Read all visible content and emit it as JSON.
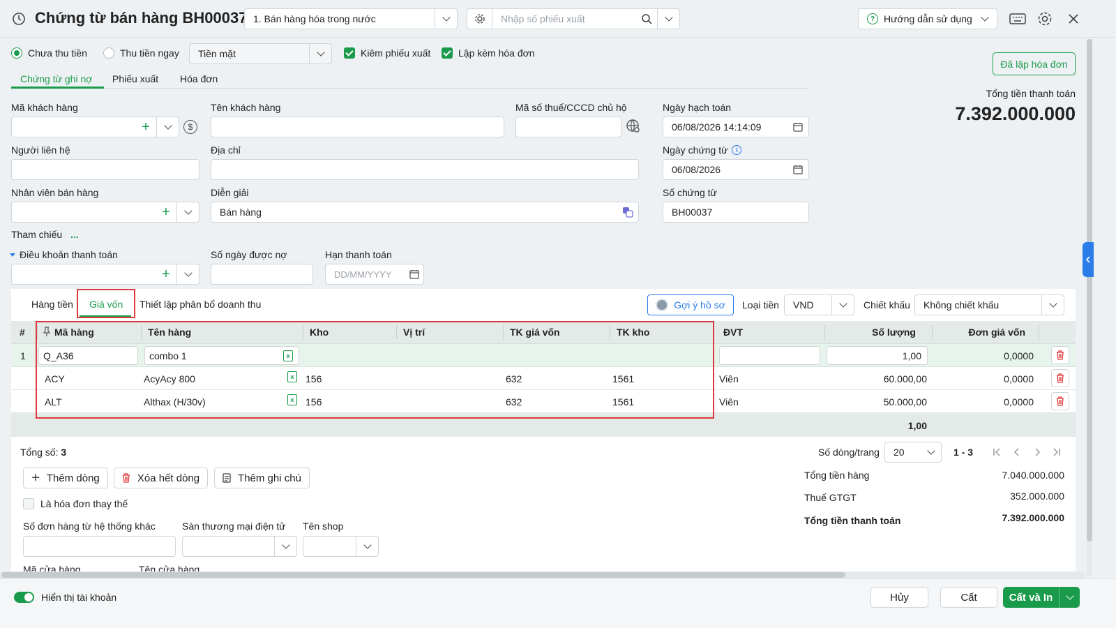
{
  "header": {
    "title": "Chứng từ bán hàng BH00037",
    "type_select": "1. Bán hàng hóa trong nước",
    "search_placeholder": "Nhập số phiếu xuất",
    "help_label": "Hướng dẫn sử dụng"
  },
  "options": {
    "radio_unpaid": "Chưa thu tiền",
    "radio_paid": "Thu tiền ngay",
    "payment_method": "Tiền mặt",
    "check_export": "Kiêm phiếu xuất",
    "check_invoice": "Lập kèm hóa đơn"
  },
  "invoice_button": "Đã lập hóa đơn",
  "total": {
    "label": "Tổng tiền thanh toán",
    "value": "7.392.000.000"
  },
  "tabs": [
    "Chứng từ ghi nợ",
    "Phiếu xuất",
    "Hóa đơn"
  ],
  "form": {
    "customer_code_label": "Mã khách hàng",
    "customer_name_label": "Tên khách hàng",
    "tax_label": "Mã số thuế/CCCD chủ hộ",
    "post_date_label": "Ngày hạch toán",
    "post_date_value": "06/08/2026 14:14:09",
    "contact_label": "Người liên hệ",
    "address_label": "Địa chỉ",
    "doc_date_label": "Ngày chứng từ",
    "doc_date_value": "06/08/2026",
    "staff_label": "Nhân viên bán hàng",
    "desc_label": "Diễn giải",
    "desc_value": "Bán hàng",
    "doc_no_label": "Số chứng từ",
    "doc_no_value": "BH00037",
    "ref_label": "Tham chiếu",
    "ref_dots": "...",
    "terms_label": "Điều khoản thanh toán",
    "days_label": "Số ngày được nợ",
    "due_label": "Hạn thanh toán",
    "due_placeholder": "DD/MM/YYYY"
  },
  "grid_tabs": [
    "Hàng tiền",
    "Giá vốn",
    "Thiết lập phân bổ doanh thu"
  ],
  "grid_toolbar": {
    "suggest": "Gợi ý hồ sơ",
    "currency_label": "Loại tiền",
    "currency": "VND",
    "discount_label": "Chiết khấu",
    "discount": "Không chiết khấu"
  },
  "table": {
    "headers": [
      "#",
      "Mã hàng",
      "Tên hàng",
      "Kho",
      "Vị trí",
      "TK giá vốn",
      "TK kho",
      "ĐVT",
      "Số lượng",
      "Đơn giá vốn"
    ],
    "rows": [
      {
        "no": "1",
        "code": "Q_A36",
        "name": "combo 1",
        "kho": "",
        "vitri": "",
        "tkgv": "",
        "tkkho": "",
        "dvt": "",
        "qty": "1,00",
        "price": "0,0000"
      },
      {
        "no": "",
        "code": "ACY",
        "name": "AcyAcy 800",
        "kho": "156",
        "vitri": "",
        "tkgv": "632",
        "tkkho": "1561",
        "dvt": "Viên",
        "qty": "60.000,00",
        "price": "0,0000"
      },
      {
        "no": "",
        "code": "ALT",
        "name": "Althax (H/30v)",
        "kho": "156",
        "vitri": "",
        "tkgv": "632",
        "tkkho": "1561",
        "dvt": "Viên",
        "qty": "50.000,00",
        "price": "0,0000"
      }
    ],
    "footer_qty": "1,00"
  },
  "footer": {
    "count_label": "Tổng số:",
    "count": "3",
    "add_row": "Thêm dòng",
    "delete_rows": "Xóa hết dòng",
    "add_note": "Thêm ghi chú",
    "replace_invoice": "Là hóa đơn thay thế",
    "other_order_label": "Số đơn hàng từ hệ thống khác",
    "ecommerce_label": "Sàn thương mại điện tử",
    "shop_label": "Tên shop",
    "store_code_label": "Mã cửa hàng",
    "store_name_label": "Tên cửa hàng",
    "rows_per_page_label": "Số dòng/trang",
    "rows_per_page": "20",
    "range": "1 - 3",
    "sum_goods_label": "Tổng tiền hàng",
    "sum_goods": "7.040.000.000",
    "vat_label": "Thuế GTGT",
    "vat": "352.000.000",
    "sum_total_label": "Tổng tiền thanh toán",
    "sum_total": "7.392.000.000"
  },
  "bottom": {
    "show_account": "Hiển thị tài khoản",
    "cancel": "Hủy",
    "save": "Cất",
    "save_print": "Cất và In"
  },
  "colors": {
    "accent": "#1a9b4b",
    "highlight": "#e0393b"
  }
}
